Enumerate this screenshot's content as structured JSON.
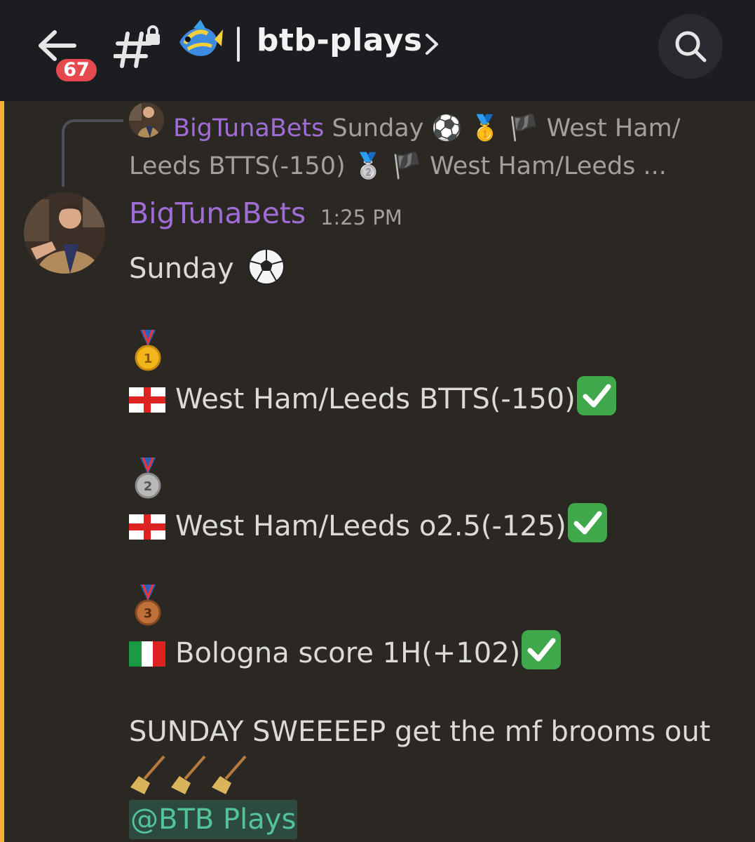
{
  "header": {
    "back_label": "Back",
    "unread_count": "67",
    "channel_name": "btb-plays",
    "channel_emoji": "tropical-fish",
    "search_label": "Search"
  },
  "reply": {
    "author": "BigTunaBets",
    "preview_line1": "Sunday ⚽ 🥇 🏴 West Ham/",
    "preview_line2": "Leeds BTTS(-150) 🥈 🏴 West Ham/Leeds ..."
  },
  "message": {
    "author": "BigTunaBets",
    "timestamp": "1:25 PM",
    "line_sunday": "Sunday",
    "play1": "West Ham/Leeds BTTS(-150)",
    "play2": "West Ham/Leeds o2.5(-125)",
    "play3": "Bologna score 1H(+102)",
    "closing": "SUNDAY SWEEEEP get the mf brooms out",
    "mention": "@BTB Plays"
  },
  "colors": {
    "topbar": "#1c1d21",
    "background": "#2b2824",
    "username": "#a06dd6",
    "accent_bar": "#f0b232",
    "badge": "#e5484d",
    "mention": "#54c39a"
  }
}
